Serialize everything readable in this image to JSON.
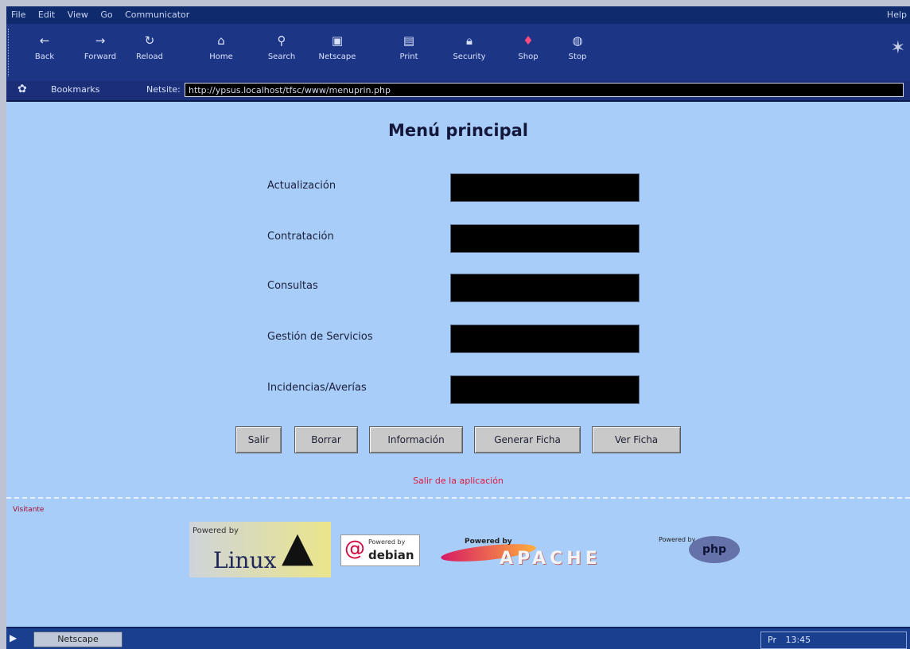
{
  "menubar": {
    "items": [
      "File",
      "Edit",
      "View",
      "Go",
      "Communicator"
    ],
    "clock": "Help"
  },
  "toolbar": {
    "buttons": [
      {
        "label": "Back",
        "icon": "back-arrow-icon"
      },
      {
        "label": "Forward",
        "icon": "forward-arrow-icon"
      },
      {
        "label": "Reload",
        "icon": "reload-icon"
      },
      {
        "label": "Home",
        "icon": "home-icon"
      },
      {
        "label": "Search",
        "icon": "search-icon"
      },
      {
        "label": "Netscape",
        "icon": "netscape-icon"
      },
      {
        "label": "Print",
        "icon": "print-icon"
      },
      {
        "label": "Security",
        "icon": "security-icon"
      },
      {
        "label": "Shop",
        "icon": "shop-icon"
      },
      {
        "label": "Stop",
        "icon": "stop-icon"
      }
    ]
  },
  "location": {
    "bookmarks_label": "Bookmarks",
    "location_label": "Netsite:",
    "url": "http://ypsus.localhost/tfsc/www/menuprin.php"
  },
  "page": {
    "title": "Menú principal",
    "fields": [
      {
        "label": "Actualización",
        "value": ""
      },
      {
        "label": "Contratación",
        "value": ""
      },
      {
        "label": "Consultas",
        "value": ""
      },
      {
        "label": "Gestión de Servicios",
        "value": ""
      },
      {
        "label": "Incidencias/Averías",
        "value": ""
      }
    ],
    "buttons": [
      "Salir",
      "Borrar",
      "Información",
      "Generar Ficha",
      "Ver Ficha"
    ],
    "logout_link": "Salir de la aplicación",
    "visits_text": "Visitante"
  },
  "badges": {
    "linux": {
      "small": "Powered by",
      "big": "Linux"
    },
    "debian": {
      "small": "Powered by",
      "big": "debian"
    },
    "apache": {
      "small": "Powered by",
      "big": "APACHE"
    },
    "php": {
      "small": "Powered by",
      "big": "php"
    }
  },
  "taskbar": {
    "task_label": "Netscape",
    "tray": [
      "Pr",
      "13:45"
    ]
  }
}
